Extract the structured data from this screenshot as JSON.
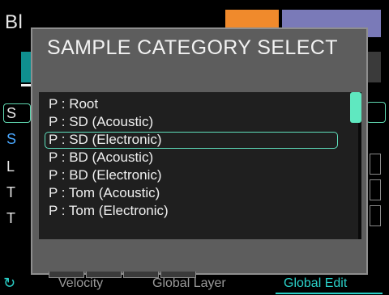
{
  "background": {
    "title": "Bl",
    "left_letters": [
      "S",
      "S",
      "L",
      "T",
      "T"
    ],
    "bottom_labels": [
      "Velocity",
      "Global Layer",
      "Global Edit"
    ],
    "icons": {
      "bottom_left": "undo-icon"
    },
    "colors": {
      "tab_orange": "#f08a2c",
      "tab_purple": "#7a7ab8",
      "accent_teal": "#2ad0c8"
    }
  },
  "dialog": {
    "title": "SAMPLE CATEGORY SELECT",
    "items": [
      {
        "label": "P : Root",
        "selected": false
      },
      {
        "label": "P : SD (Acoustic)",
        "selected": false
      },
      {
        "label": "P : SD (Electronic)",
        "selected": true
      },
      {
        "label": "P : BD (Acoustic)",
        "selected": false
      },
      {
        "label": "P : BD (Electronic)",
        "selected": false
      },
      {
        "label": "P : Tom (Acoustic)",
        "selected": false
      },
      {
        "label": "P : Tom (Electronic)",
        "selected": false
      }
    ],
    "colors": {
      "selection_outline": "#5fe0bd",
      "scroll_thumb": "#5fe8c0",
      "panel_bg": "#1f1f1f",
      "dialog_bg": "#5d5d5d"
    }
  }
}
